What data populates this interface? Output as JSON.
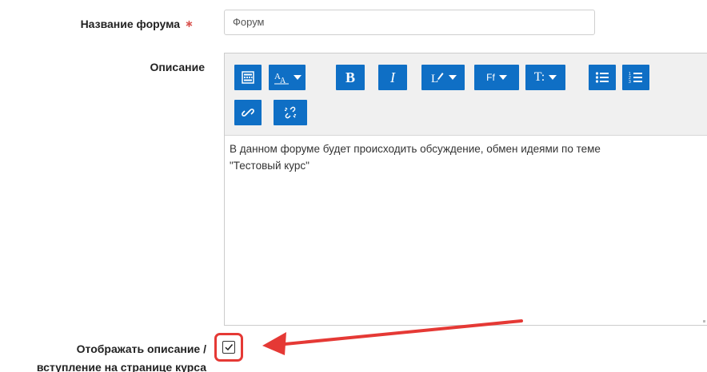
{
  "form": {
    "forum_name": {
      "label": "Название форума",
      "required_mark": "∗",
      "value": "Форум"
    },
    "description": {
      "label": "Описание",
      "text_line1": "В данном форуме будет происходить обсуждение, обмен идеями по теме",
      "text_line2": "\"Тестовый курс\""
    },
    "show_description": {
      "label_line1": "Отображать описание /",
      "label_line2": "вступление на странице курса",
      "checked": true
    }
  },
  "toolbar": {
    "buttons": [
      {
        "name": "toolbar-toggle-icon"
      },
      {
        "name": "font-size-icon"
      },
      {
        "name": "bold-icon",
        "label": "B"
      },
      {
        "name": "italic-icon",
        "label": "I"
      },
      {
        "name": "style-icon"
      },
      {
        "name": "font-family-icon",
        "label": "Ff"
      },
      {
        "name": "paragraph-format-icon",
        "label": "T:"
      },
      {
        "name": "unordered-list-icon"
      },
      {
        "name": "ordered-list-icon"
      },
      {
        "name": "link-icon"
      },
      {
        "name": "unlink-icon"
      }
    ]
  },
  "colors": {
    "toolbar_button": "#0f6fc5",
    "highlight": "#e53935",
    "required": "#d9534f"
  }
}
